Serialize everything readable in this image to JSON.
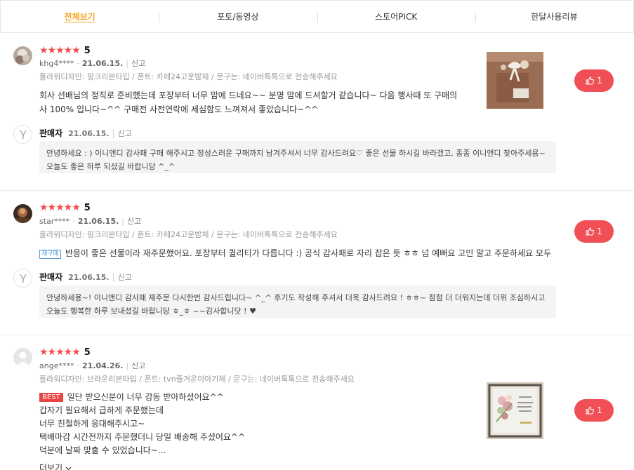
{
  "tabs": [
    {
      "label": "전체보기",
      "active": true
    },
    {
      "label": "포토/동영상"
    },
    {
      "label": "스토어PICK"
    },
    {
      "label": "한달사용리뷰"
    }
  ],
  "colors": {
    "star": "#f04e4e",
    "like": "#ef4f55",
    "active_tab": "#f5a623"
  },
  "reviews": [
    {
      "rating": 5,
      "stars": "★★★★★",
      "score_label": "5",
      "user": "khg4****",
      "date": "21.06.15.",
      "report": "신고",
      "options": "플라워디자인: 핑크리본타입 / 폰트: 카페24고운밤체 / 문구는: 네이버톡톡으로 전송해주세요",
      "text": "회사 선배님의 정직로 준비했는데 포장부터 너무 맘에 드네요~~ 분명 맘에 드셔할거 같습니다~ 다음 행사때 또 구매의사 100% 입니다~^^ 구매전 사전연락에 세심함도 느껴져서 좋았습니다~^^",
      "likes": "1",
      "seller": {
        "name": "판매자",
        "date": "21.06.15.",
        "report": "신고",
        "reply": "안녕하세요 : ) 이니앤디 감사패 구매 해주시고 정성스러운 구매까지 남겨주셔서 너무 감사드려요♡ 좋은 선물 하시길 바라겠고, 종종 이니앤디 찾아주세용~ 오늘도 좋은 하루 되셨길 바랍니당 ^_^"
      }
    },
    {
      "rating": 5,
      "stars": "★★★★★",
      "score_label": "5",
      "user": "star****",
      "date": "21.06.15.",
      "report": "신고",
      "options": "플라워디자인: 핑크리본타입 / 폰트: 카페24고운밤체 / 문구는: 네이버톡톡으로 전송해주세요",
      "tag": "재구매",
      "text": "반응이 좋은 선물이라 재주문했어요. 포장부터 퀄리티가 다릅니다 :) 공식 감사패로 자리 잡은 듯 ㅎㅎ 넘 예뻐요 고민 말고 주문하세요 모두",
      "likes": "1",
      "seller": {
        "name": "판매자",
        "date": "21.06.15.",
        "report": "신고",
        "reply": "안녕하세용~! 이니앤디 감사패 재주문 다시한번 감사드립니다~   ^_^ 후기도 작성해 주셔서 더욱 감사드려요 ! ㅎㅎ~ 점점 더 더워지는데 더위 조심하시고 오늘도 행복한 하루 보내셨길 바랍니당 ㅎ_ㅎ ~~감사합니닷 ! ♥"
      }
    },
    {
      "rating": 5,
      "stars": "★★★★★",
      "score_label": "5",
      "user": "ange****",
      "date": "21.04.26.",
      "report": "신고",
      "options": "플라워디자인: 브라운리본타입 / 폰트: tvn즐거운이야기체 / 문구는: 네이버톡톡으로 전송해주세요",
      "tag": "BEST",
      "lines": [
        "일단 받으신분이 너무 감동 받아하셨어요^^",
        "갑자기 필요해서 급하게 주문했는데",
        "너무 친절하게 응대해주시고~",
        "택배마감 시간전까지 주문했더니 당일 배송해 주셨어요^^",
        "덕분에 날짜 맞출 수 있었습니다~..."
      ],
      "more": "더보기",
      "likes": "1"
    }
  ]
}
